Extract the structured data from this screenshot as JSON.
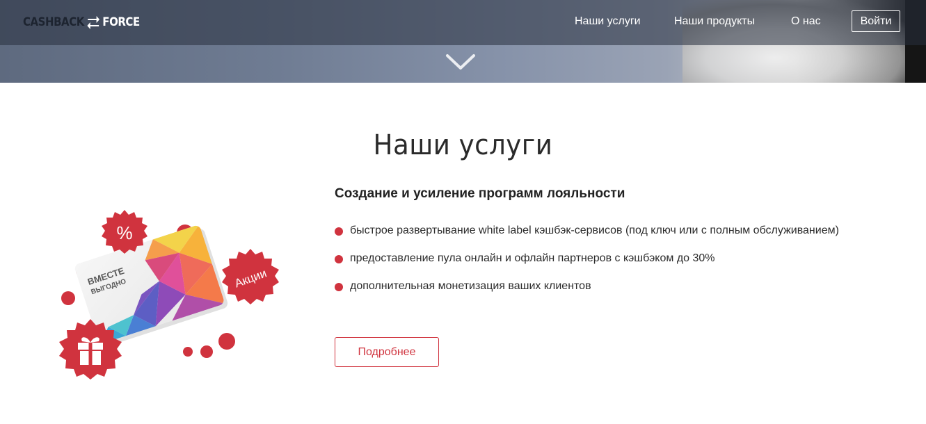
{
  "brand": {
    "logo_part1": "CASHBACK",
    "logo_part2": "FORCE",
    "accent_color": "#d0333e"
  },
  "nav": {
    "items": [
      {
        "label": "Наши услуги"
      },
      {
        "label": "Наши продукты"
      },
      {
        "label": "О нас"
      }
    ],
    "login_label": "Войти",
    "scroll_icon": "chevron-down-icon"
  },
  "services": {
    "title": "Наши услуги",
    "subtitle": "Создание и усиление программ лояльности",
    "bullets": [
      "быстрое развертывание white label кэшбэк-сервисов (под ключ или с полным обслуживанием)",
      "предоставление пула онлайн и офлайн партнеров с кэшбэком до 30%",
      "дополнительная монетизация ваших клиентов"
    ],
    "more_label": "Подробнее",
    "illustration": {
      "card_line1": "ВМЕСТЕ",
      "card_line2": "ВЫГОДНО",
      "badge_percent": "%",
      "badge_promo": "Акции",
      "badge_gift_icon": "gift-icon"
    }
  }
}
